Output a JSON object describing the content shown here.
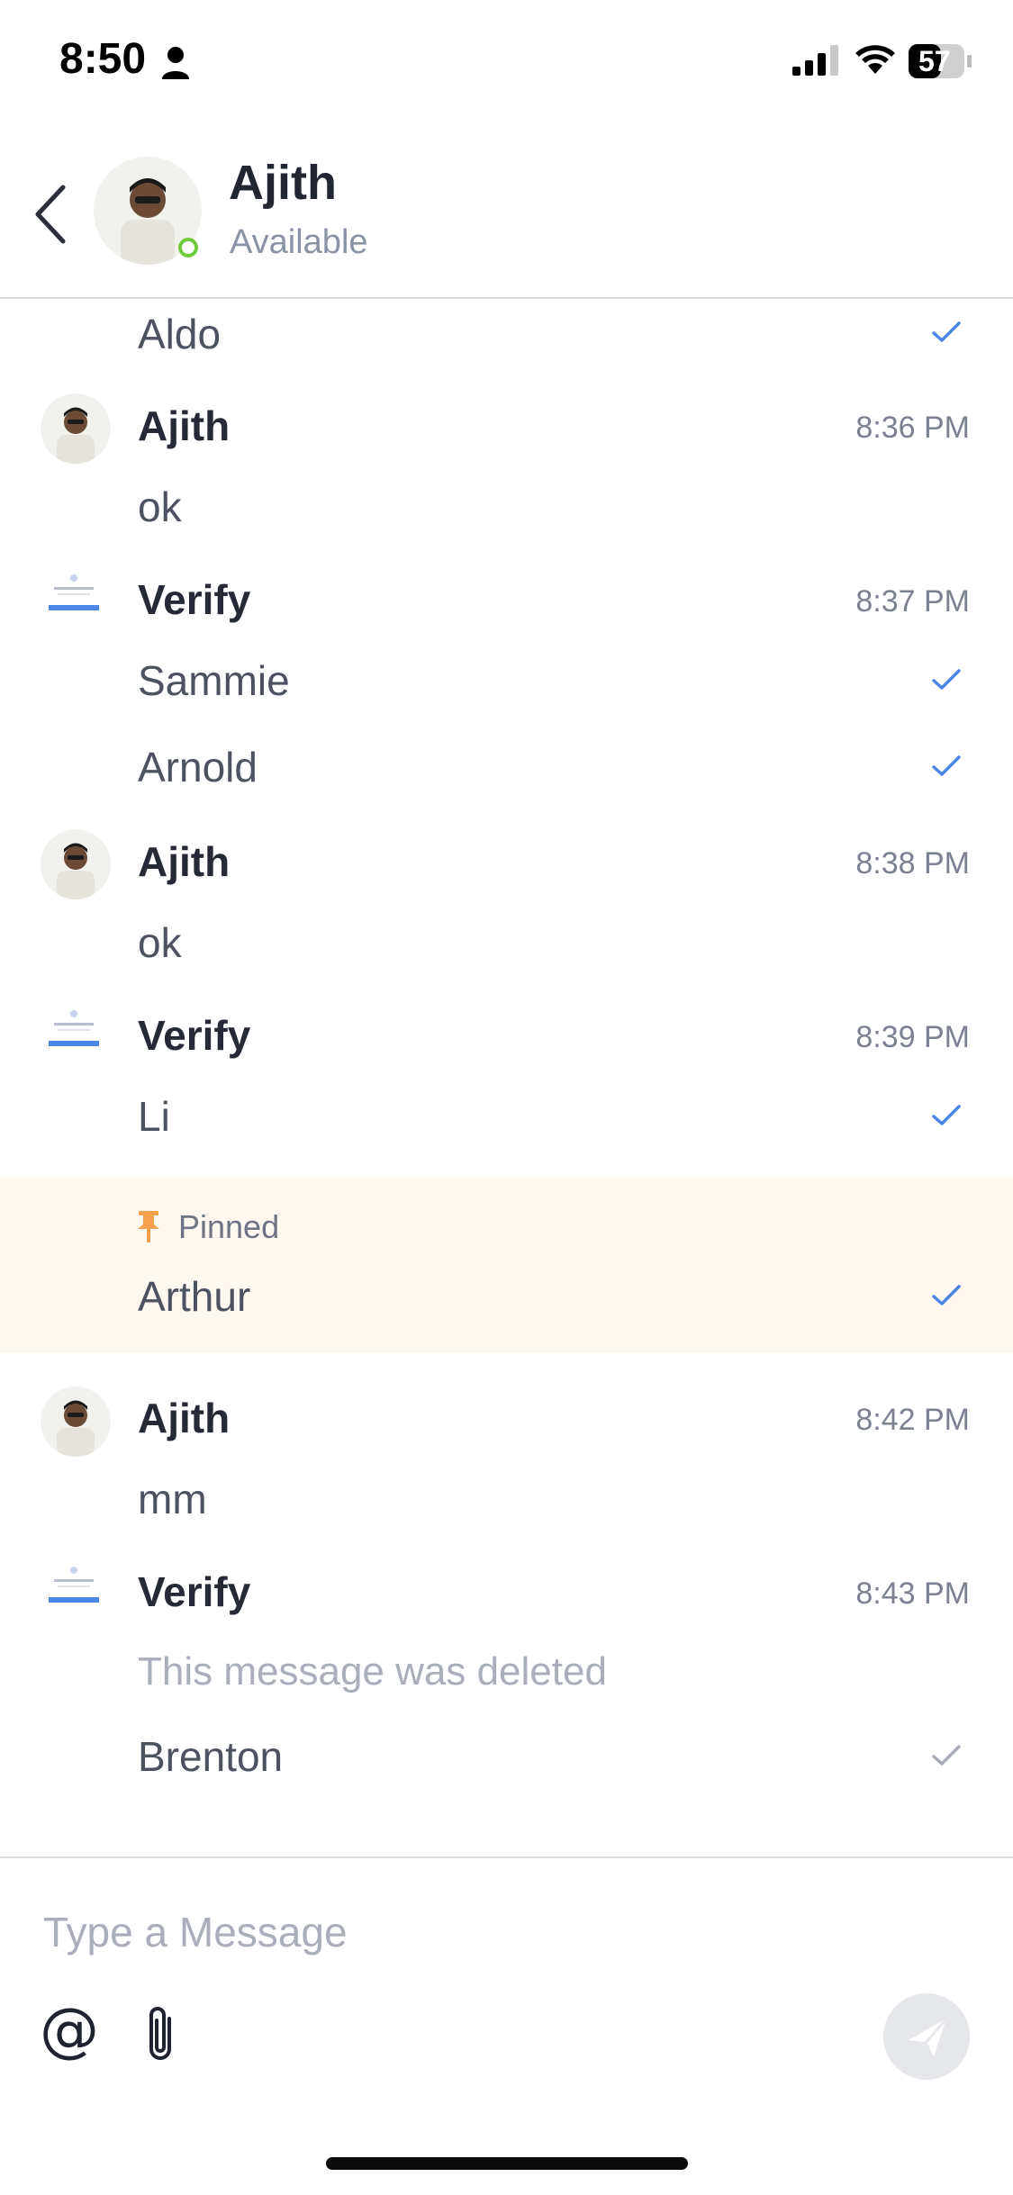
{
  "status_bar": {
    "time": "8:50",
    "battery": "57"
  },
  "header": {
    "contact_name": "Ajith",
    "contact_status": "Available",
    "accent_online": "#6ecb3a"
  },
  "messages": {
    "m0": {
      "text": "Aldo"
    },
    "g1": {
      "sender": "Ajith",
      "time": "8:36 PM",
      "text": "ok"
    },
    "g2": {
      "sender": "Verify",
      "time": "8:37 PM",
      "text1": "Sammie",
      "text2": "Arnold"
    },
    "g3": {
      "sender": "Ajith",
      "time": "8:38 PM",
      "text": "ok"
    },
    "g4": {
      "sender": "Verify",
      "time": "8:39 PM",
      "text": "Li"
    },
    "pinned": {
      "label": "Pinned",
      "text": "Arthur"
    },
    "g5": {
      "sender": "Ajith",
      "time": "8:42 PM",
      "text": "mm"
    },
    "g6": {
      "sender": "Verify",
      "time": "8:43 PM",
      "deleted": "This message was deleted",
      "text": "Brenton"
    }
  },
  "composer": {
    "placeholder": "Type a Message",
    "mention_symbol": "@"
  },
  "colors": {
    "tick_blue": "#4a86e8",
    "tick_grey": "#a7acb6",
    "pinned_bg": "#fef8f1",
    "pin_orange": "#f5a14b"
  }
}
